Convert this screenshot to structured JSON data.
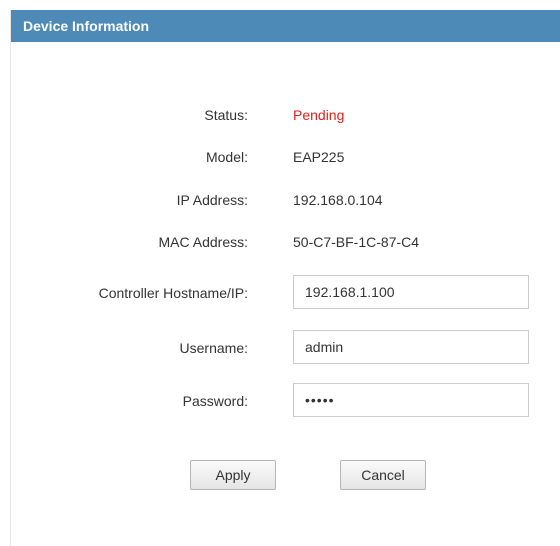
{
  "header": {
    "title": "Device Information"
  },
  "fields": {
    "status": {
      "label": "Status:",
      "value": "Pending"
    },
    "model": {
      "label": "Model:",
      "value": "EAP225"
    },
    "ip_address": {
      "label": "IP Address:",
      "value": "192.168.0.104"
    },
    "mac_address": {
      "label": "MAC Address:",
      "value": "50-C7-BF-1C-87-C4"
    },
    "controller": {
      "label": "Controller Hostname/IP:",
      "value": "192.168.1.100"
    },
    "username": {
      "label": "Username:",
      "value": "admin"
    },
    "password": {
      "label": "Password:",
      "value": "•••••"
    }
  },
  "buttons": {
    "apply_label": "Apply",
    "cancel_label": "Cancel"
  },
  "colors": {
    "header_bg": "#4d8ab8",
    "status_pending": "#e0201b"
  }
}
